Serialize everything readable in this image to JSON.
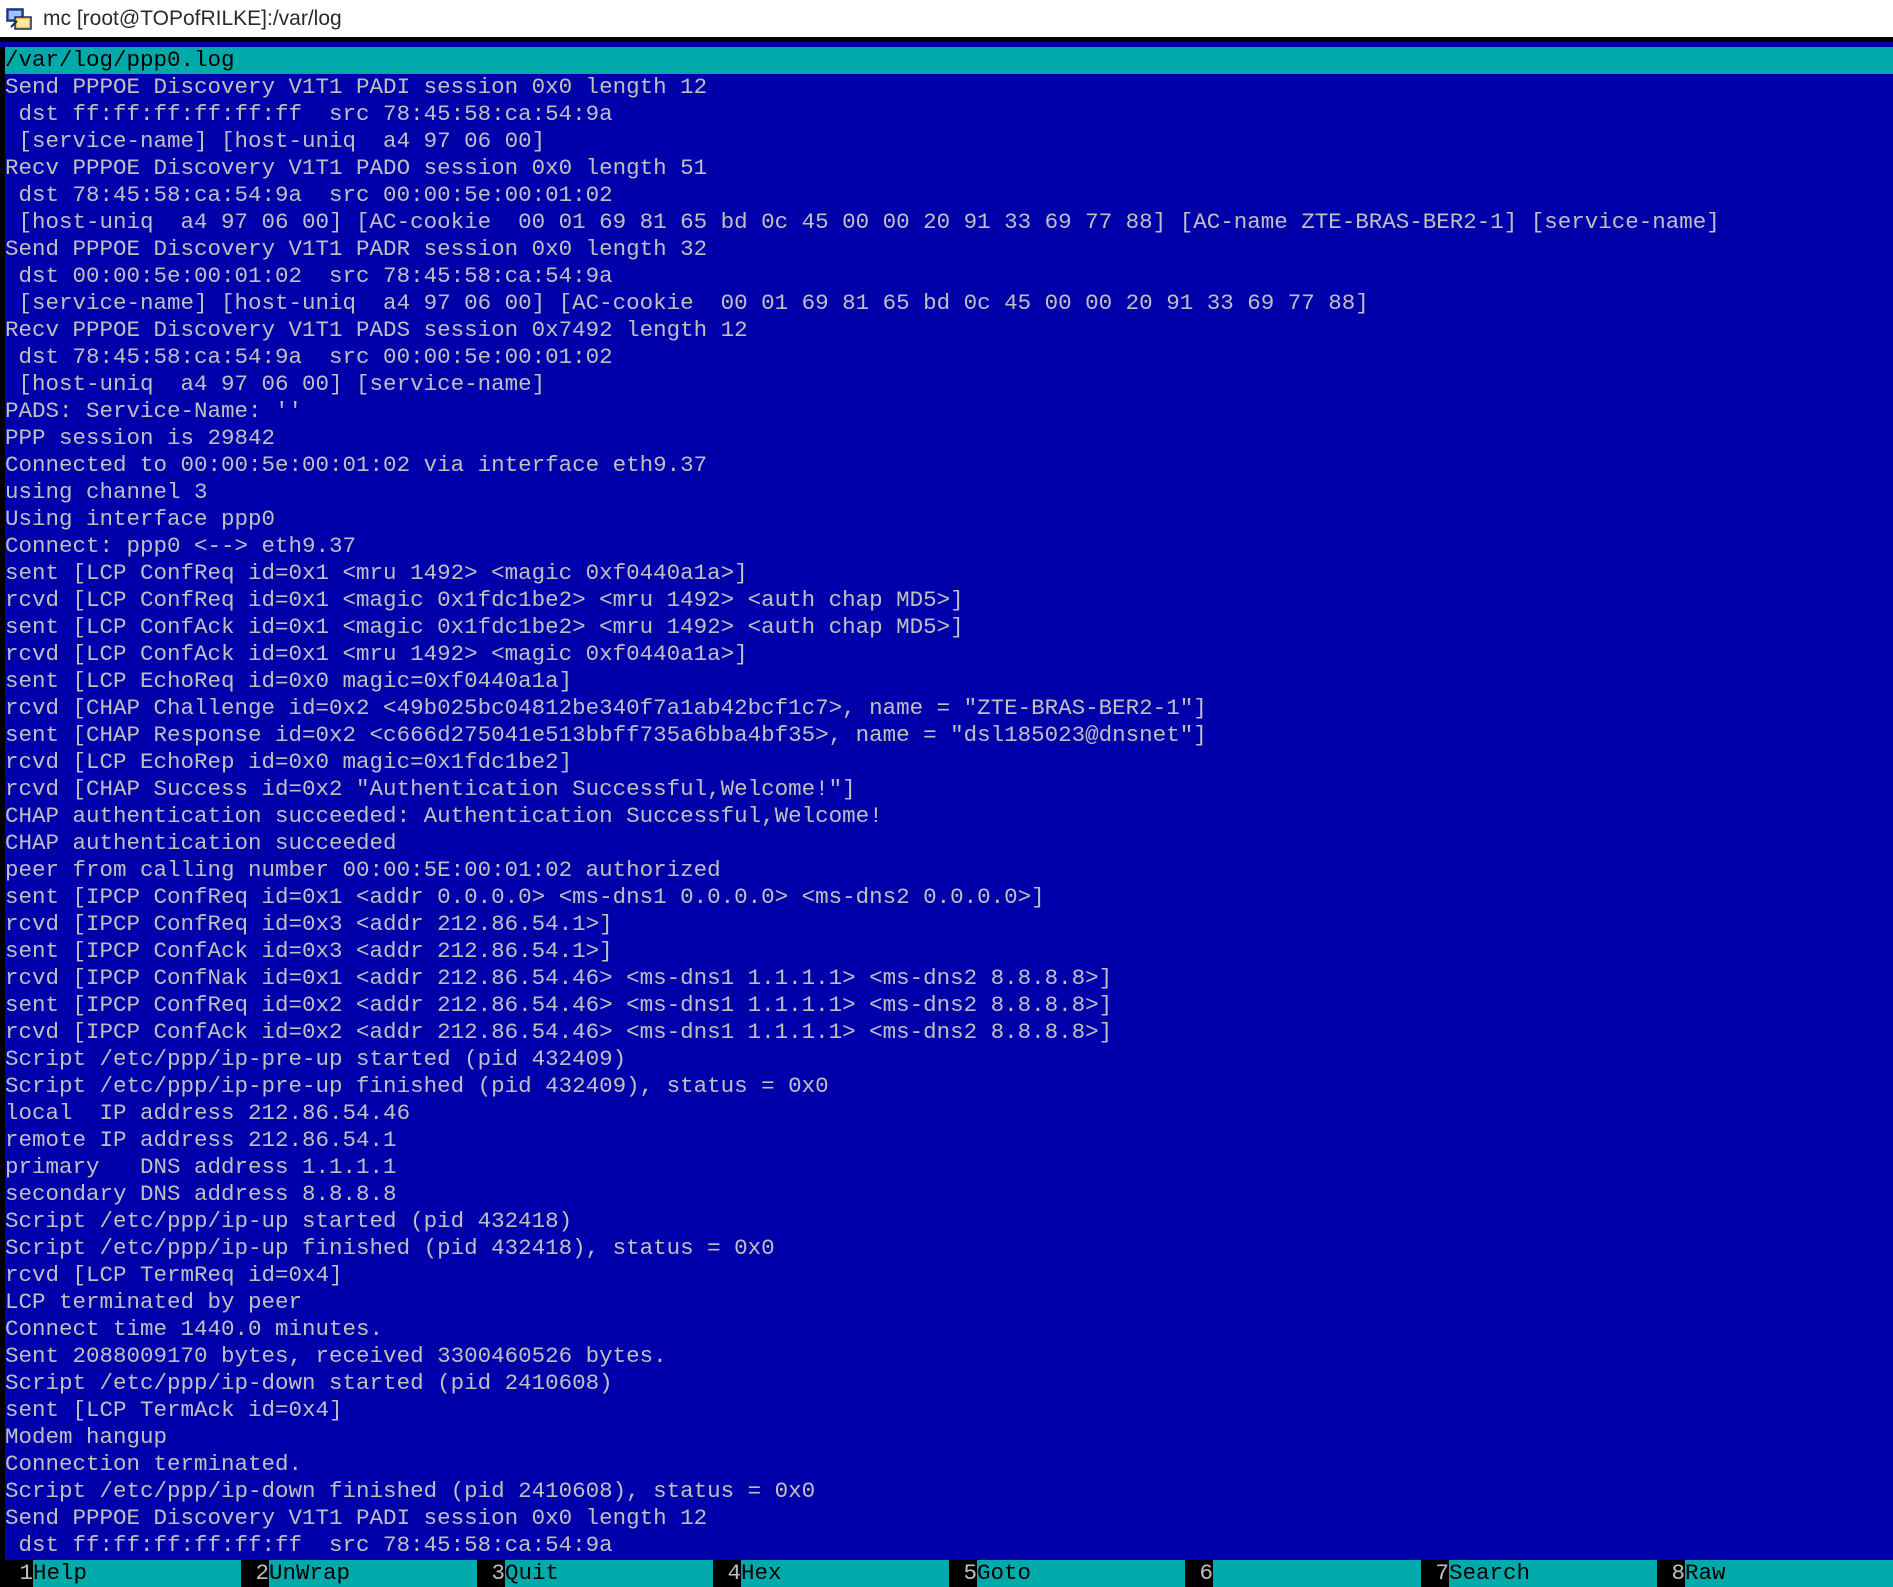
{
  "window": {
    "title": "mc [root@TOPofRILKE]:/var/log",
    "icon": "terminal-app-icon",
    "colors": {
      "background": "#0000aa",
      "text": "#c0c0c0",
      "bar": "#00aaaa",
      "bar_text": "#000000"
    }
  },
  "viewer": {
    "file_path": "/var/log/ppp0.log",
    "lines": [
      "Send PPPOE Discovery V1T1 PADI session 0x0 length 12",
      " dst ff:ff:ff:ff:ff:ff  src 78:45:58:ca:54:9a",
      " [service-name] [host-uniq  a4 97 06 00]",
      "Recv PPPOE Discovery V1T1 PADO session 0x0 length 51",
      " dst 78:45:58:ca:54:9a  src 00:00:5e:00:01:02",
      " [host-uniq  a4 97 06 00] [AC-cookie  00 01 69 81 65 bd 0c 45 00 00 20 91 33 69 77 88] [AC-name ZTE-BRAS-BER2-1] [service-name]",
      "Send PPPOE Discovery V1T1 PADR session 0x0 length 32",
      " dst 00:00:5e:00:01:02  src 78:45:58:ca:54:9a",
      " [service-name] [host-uniq  a4 97 06 00] [AC-cookie  00 01 69 81 65 bd 0c 45 00 00 20 91 33 69 77 88]",
      "Recv PPPOE Discovery V1T1 PADS session 0x7492 length 12",
      " dst 78:45:58:ca:54:9a  src 00:00:5e:00:01:02",
      " [host-uniq  a4 97 06 00] [service-name]",
      "PADS: Service-Name: ''",
      "PPP session is 29842",
      "Connected to 00:00:5e:00:01:02 via interface eth9.37",
      "using channel 3",
      "Using interface ppp0",
      "Connect: ppp0 <--> eth9.37",
      "sent [LCP ConfReq id=0x1 <mru 1492> <magic 0xf0440a1a>]",
      "rcvd [LCP ConfReq id=0x1 <magic 0x1fdc1be2> <mru 1492> <auth chap MD5>]",
      "sent [LCP ConfAck id=0x1 <magic 0x1fdc1be2> <mru 1492> <auth chap MD5>]",
      "rcvd [LCP ConfAck id=0x1 <mru 1492> <magic 0xf0440a1a>]",
      "sent [LCP EchoReq id=0x0 magic=0xf0440a1a]",
      "rcvd [CHAP Challenge id=0x2 <49b025bc04812be340f7a1ab42bcf1c7>, name = \"ZTE-BRAS-BER2-1\"]",
      "sent [CHAP Response id=0x2 <c666d275041e513bbff735a6bba4bf35>, name = \"dsl185023@dnsnet\"]",
      "rcvd [LCP EchoRep id=0x0 magic=0x1fdc1be2]",
      "rcvd [CHAP Success id=0x2 \"Authentication Successful,Welcome!\"]",
      "CHAP authentication succeeded: Authentication Successful,Welcome!",
      "CHAP authentication succeeded",
      "peer from calling number 00:00:5E:00:01:02 authorized",
      "sent [IPCP ConfReq id=0x1 <addr 0.0.0.0> <ms-dns1 0.0.0.0> <ms-dns2 0.0.0.0>]",
      "rcvd [IPCP ConfReq id=0x3 <addr 212.86.54.1>]",
      "sent [IPCP ConfAck id=0x3 <addr 212.86.54.1>]",
      "rcvd [IPCP ConfNak id=0x1 <addr 212.86.54.46> <ms-dns1 1.1.1.1> <ms-dns2 8.8.8.8>]",
      "sent [IPCP ConfReq id=0x2 <addr 212.86.54.46> <ms-dns1 1.1.1.1> <ms-dns2 8.8.8.8>]",
      "rcvd [IPCP ConfAck id=0x2 <addr 212.86.54.46> <ms-dns1 1.1.1.1> <ms-dns2 8.8.8.8>]",
      "Script /etc/ppp/ip-pre-up started (pid 432409)",
      "Script /etc/ppp/ip-pre-up finished (pid 432409), status = 0x0",
      "local  IP address 212.86.54.46",
      "remote IP address 212.86.54.1",
      "primary   DNS address 1.1.1.1",
      "secondary DNS address 8.8.8.8",
      "Script /etc/ppp/ip-up started (pid 432418)",
      "Script /etc/ppp/ip-up finished (pid 432418), status = 0x0",
      "rcvd [LCP TermReq id=0x4]",
      "LCP terminated by peer",
      "Connect time 1440.0 minutes.",
      "Sent 2088009170 bytes, received 3300460526 bytes.",
      "Script /etc/ppp/ip-down started (pid 2410608)",
      "sent [LCP TermAck id=0x4]",
      "Modem hangup",
      "Connection terminated.",
      "Script /etc/ppp/ip-down finished (pid 2410608), status = 0x0",
      "Send PPPOE Discovery V1T1 PADI session 0x0 length 12",
      " dst ff:ff:ff:ff:ff:ff  src 78:45:58:ca:54:9a"
    ]
  },
  "function_keys": [
    {
      "num": "1",
      "label": "Help",
      "name": "f1-help-key"
    },
    {
      "num": "2",
      "label": "UnWrap",
      "name": "f2-unwrap-key"
    },
    {
      "num": "3",
      "label": "Quit",
      "name": "f3-quit-key"
    },
    {
      "num": "4",
      "label": "Hex",
      "name": "f4-hex-key"
    },
    {
      "num": "5",
      "label": "Goto",
      "name": "f5-goto-key"
    },
    {
      "num": "6",
      "label": "",
      "name": "f6-key"
    },
    {
      "num": "7",
      "label": "Search",
      "name": "f7-search-key"
    },
    {
      "num": "8",
      "label": "Raw",
      "name": "f8-raw-key"
    }
  ]
}
